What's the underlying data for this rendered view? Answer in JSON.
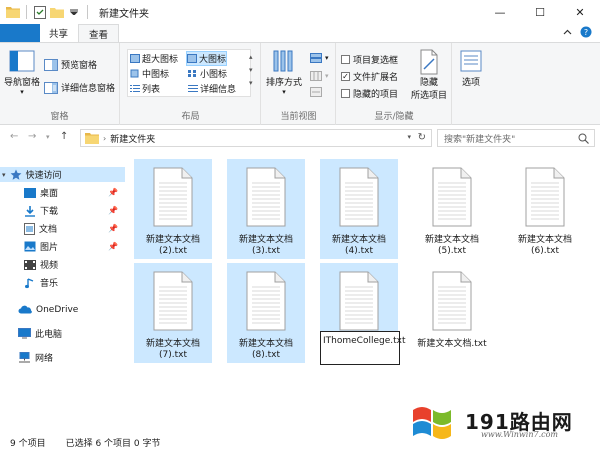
{
  "window": {
    "title": "新建文件夹",
    "minimize": "—",
    "maximize": "☐",
    "close": "✕"
  },
  "tabs": [
    {
      "label": "文件"
    },
    {
      "label": "主页"
    },
    {
      "label": "共享"
    },
    {
      "label": "查看"
    }
  ],
  "ribbon": {
    "panes": {
      "navigation_pane": "导航窗格",
      "preview_pane": "预览窗格",
      "details_pane": "详细信息窗格",
      "group_label": "窗格"
    },
    "layout": {
      "extra_large_icons": "超大图标",
      "large_icons": "大图标",
      "medium_icons": "中图标",
      "small_icons": "小图标",
      "list": "列表",
      "details": "详细信息",
      "group_label": "布局"
    },
    "current_view": {
      "sort_by": "排序方式",
      "group_label": "当前视图"
    },
    "show_hide": {
      "item_checkboxes": "项目复选框",
      "item_checkboxes_checked": false,
      "file_extensions": "文件扩展名",
      "file_extensions_checked": true,
      "hidden_items": "隐藏的项目",
      "hidden_items_checked": false,
      "hide_selected": "隐藏",
      "hide_selected_line2": "所选项目",
      "group_label": "显示/隐藏"
    },
    "options": "选项"
  },
  "address": {
    "path": "新建文件夹",
    "search_placeholder": "搜索\"新建文件夹\""
  },
  "nav": {
    "quick_access": "快速访问",
    "desktop": "桌面",
    "downloads": "下载",
    "documents": "文档",
    "pictures": "图片",
    "videos": "视频",
    "music": "音乐",
    "onedrive": "OneDrive",
    "this_pc": "此电脑",
    "network": "网络"
  },
  "files": [
    {
      "name": "新建文本文档\n(2).txt",
      "selected": true
    },
    {
      "name": "新建文本文档\n(3).txt",
      "selected": true
    },
    {
      "name": "新建文本文档\n(4).txt",
      "selected": true
    },
    {
      "name": "新建文本文档\n(5).txt",
      "selected": false
    },
    {
      "name": "新建文本文档\n(6).txt",
      "selected": false
    },
    {
      "name": "新建文本文档\n(7).txt",
      "selected": true
    },
    {
      "name": "新建文本文档\n(8).txt",
      "selected": true
    },
    {
      "name": "IThomeCollege.txt",
      "selected": true,
      "renaming": true
    },
    {
      "name": "新建文本文档.txt",
      "selected": false
    }
  ],
  "rename_value": "IThomeCollege.txt",
  "status": {
    "item_count": "9 个项目",
    "selected": "已选择 6 个项目  0 字节"
  },
  "watermark": {
    "text": "191路由网",
    "url": "www.Winwin7.com"
  },
  "colors": {
    "accent": "#1979ca",
    "selection": "#cce8ff"
  }
}
